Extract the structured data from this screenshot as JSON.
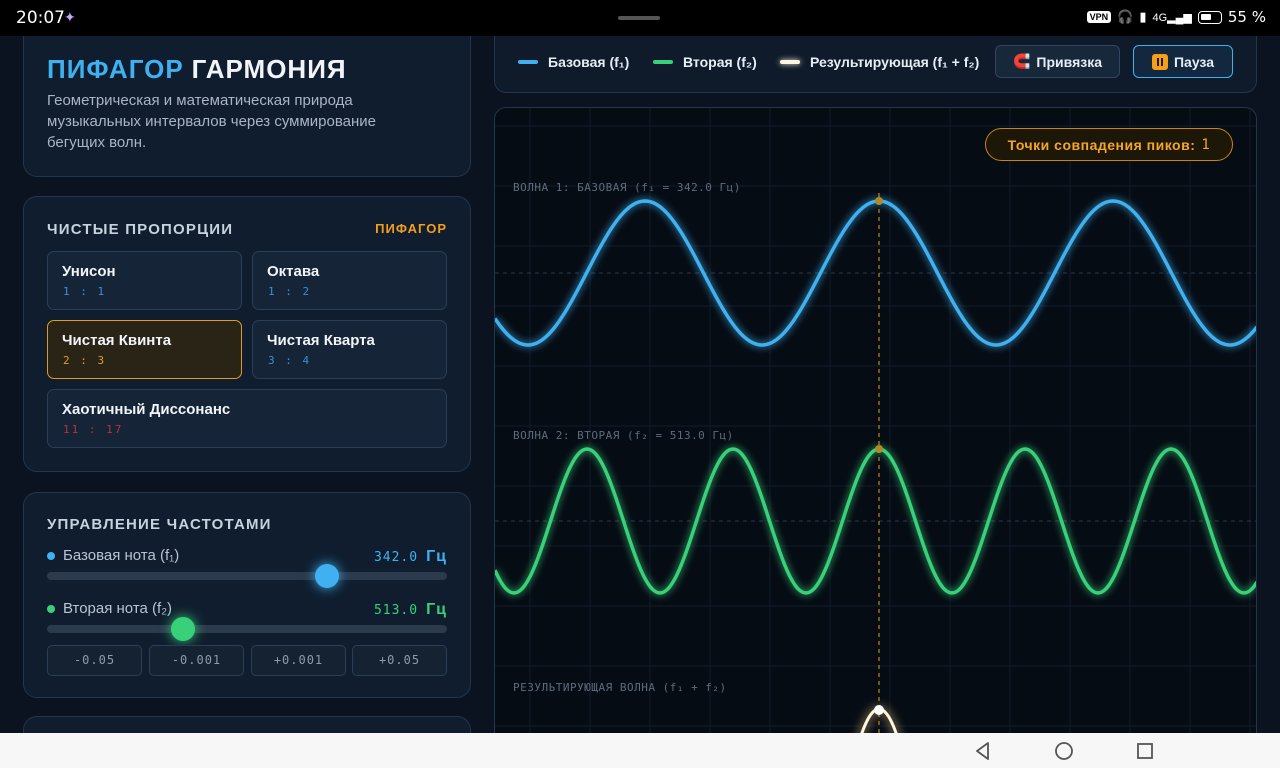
{
  "status_bar": {
    "time": "20:07",
    "vpn": "VPN",
    "net": "4G",
    "battery_percent": "55 %"
  },
  "header": {
    "brand_part1": "ПИФАГОР",
    "brand_part2": "ГАРМОНИЯ",
    "subtitle": "Геометрическая и математическая природа музыкальных интервалов через суммирование бегущих волн."
  },
  "proportions": {
    "title": "ЧИСТЫЕ ПРОПОРЦИИ",
    "tag": "ПИФАГОР",
    "items": [
      {
        "name": "Унисон",
        "ratio": "1 : 1",
        "ratio_color": "#3b8fd6",
        "active": false
      },
      {
        "name": "Октава",
        "ratio": "1 : 2",
        "ratio_color": "#3b8fd6",
        "active": false
      },
      {
        "name": "Чистая Квинта",
        "ratio": "2 : 3",
        "ratio_color": "#e09c22",
        "active": true
      },
      {
        "name": "Чистая Кварта",
        "ratio": "3 : 4",
        "ratio_color": "#3b8fd6",
        "active": false
      },
      {
        "name": "Хаотичный Диссонанс",
        "ratio": "11 : 17",
        "ratio_color": "#b8323f",
        "active": false
      }
    ]
  },
  "frequency_control": {
    "title": "УПРАВЛЕНИЕ ЧАСТОТАМИ",
    "base": {
      "label": "Базовая нота (f₁)",
      "value": "342.0",
      "unit": "Гц",
      "color": "#3fb1f0",
      "slider_fraction": 0.7
    },
    "second": {
      "label": "Вторая нота (f₂)",
      "value": "513.0",
      "unit": "Гц",
      "color": "#38d17a",
      "slider_fraction": 0.34
    },
    "steps": [
      "-0.05",
      "-0.001",
      "+0.001",
      "+0.05"
    ]
  },
  "legend": {
    "base": "Базовая (f₁)",
    "second": "Вторая (f₂)",
    "result": "Результирующая (f₁ + f₂)",
    "base_color": "#3fb1f0",
    "second_color": "#38d17a",
    "result_color": "#fff6e0"
  },
  "controls": {
    "snap_label": "Привязка",
    "pause_label": "Пауза"
  },
  "scope": {
    "peak_badge_label": "Точки совпадения пиков:",
    "peak_count": "1",
    "wave1_label": "ВОЛНА 1: БАЗОВАЯ (f₁ = 342.0 Гц)",
    "wave2_label": "ВОЛНА 2: ВТОРАЯ (f₂ = 513.0 Гц)",
    "result_label": "РЕЗУЛЬТИРУЮЩАЯ ВОЛНА (f₁ + f₂)",
    "wave1_color": "#3fb1f0",
    "wave2_color": "#38d17a",
    "marker_color": "#c98416"
  }
}
